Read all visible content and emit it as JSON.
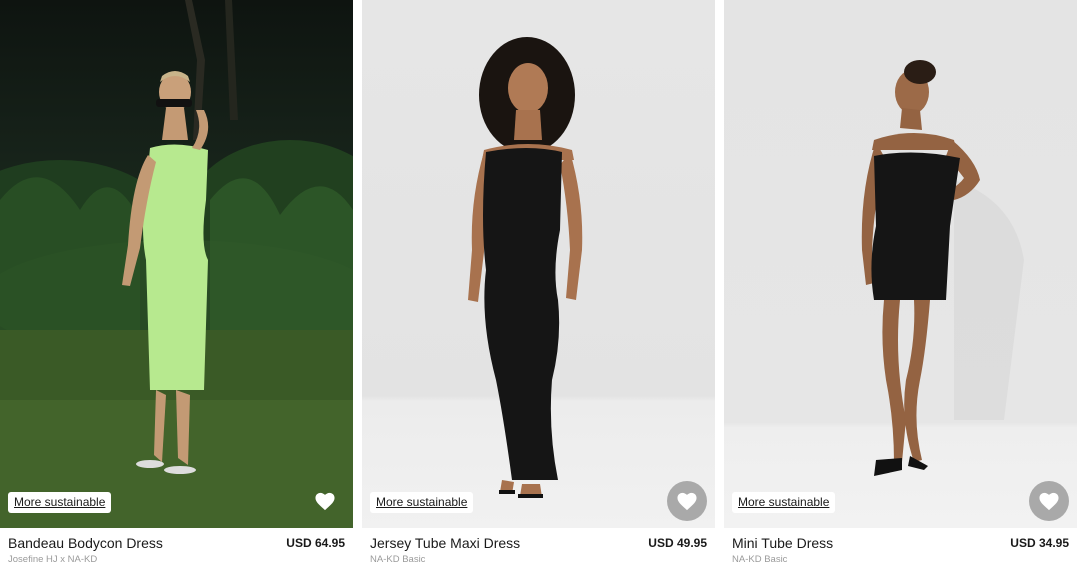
{
  "colors": {
    "badge_bg": "#ffffff",
    "favorite_filled_bg": "#a9a9a9",
    "brand_text": "#9a9a9a",
    "dress_green": "#b7e98f",
    "dress_black": "#151515"
  },
  "products": [
    {
      "name": "Bandeau Bodycon Dress",
      "price": "USD 64.95",
      "brand": "Josefine HJ x NA-KD",
      "badge": "More sustainable",
      "favorite_icon": "heart-icon"
    },
    {
      "name": "Jersey Tube Maxi Dress",
      "price": "USD 49.95",
      "brand": "NA-KD Basic",
      "badge": "More sustainable",
      "favorite_icon": "heart-icon"
    },
    {
      "name": "Mini Tube Dress",
      "price": "USD 34.95",
      "brand": "NA-KD Basic",
      "badge": "More sustainable",
      "favorite_icon": "heart-icon"
    }
  ]
}
